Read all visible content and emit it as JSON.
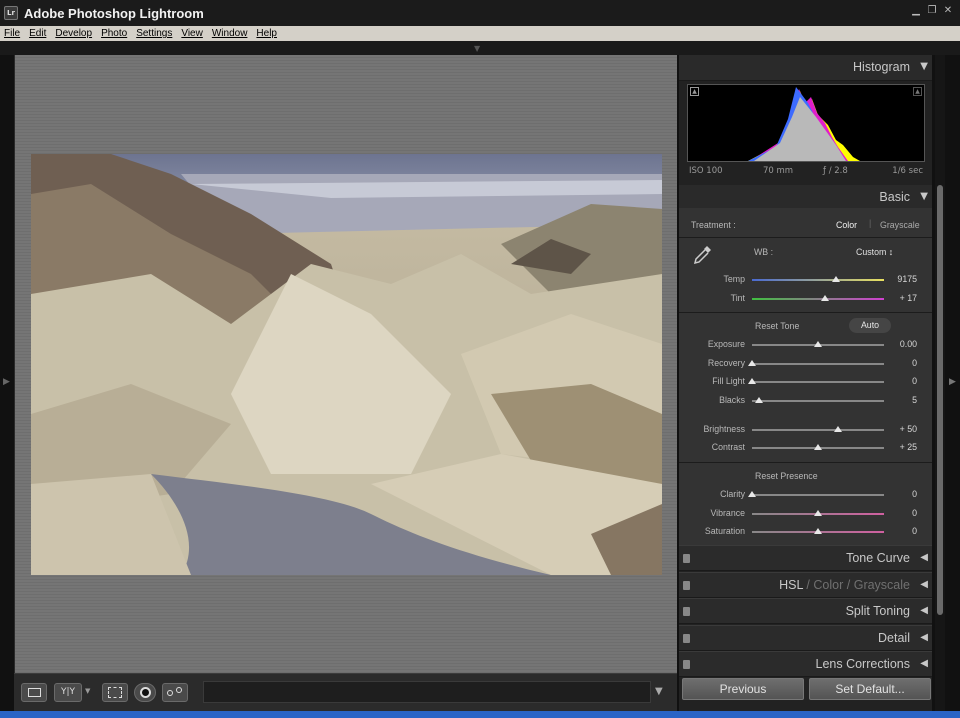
{
  "window": {
    "title": "Adobe Photoshop Lightroom",
    "icon_text": "Lr"
  },
  "menu": [
    "File",
    "Edit",
    "Develop",
    "Photo",
    "Settings",
    "View",
    "Window",
    "Help"
  ],
  "panels": {
    "histogram": {
      "title": "Histogram",
      "iso": "ISO 100",
      "focal": "70 mm",
      "aperture": "ƒ / 2.8",
      "shutter": "1/6 sec"
    },
    "basic": {
      "title": "Basic",
      "treatment_label": "Treatment :",
      "treatment_color": "Color",
      "treatment_grayscale": "Grayscale",
      "wb_label": "WB :",
      "wb_value": "Custom ↕",
      "temp": {
        "label": "Temp",
        "value": "9175",
        "level": 0.64
      },
      "tint": {
        "label": "Tint",
        "value": "+ 17",
        "level": 0.55
      },
      "reset_tone": "Reset Tone",
      "auto": "Auto",
      "exposure": {
        "label": "Exposure",
        "value": "0.00",
        "level": 0.5
      },
      "recovery": {
        "label": "Recovery",
        "value": "0",
        "level": 0.0
      },
      "fill_light": {
        "label": "Fill Light",
        "value": "0",
        "level": 0.0
      },
      "blacks": {
        "label": "Blacks",
        "value": "5",
        "level": 0.05
      },
      "brightness": {
        "label": "Brightness",
        "value": "+ 50",
        "level": 0.65
      },
      "contrast": {
        "label": "Contrast",
        "value": "+ 25",
        "level": 0.5
      },
      "reset_presence": "Reset Presence",
      "clarity": {
        "label": "Clarity",
        "value": "0",
        "level": 0.0
      },
      "vibrance": {
        "label": "Vibrance",
        "value": "0",
        "level": 0.5
      },
      "saturation": {
        "label": "Saturation",
        "value": "0",
        "level": 0.5
      }
    },
    "tone_curve": "Tone Curve",
    "hsl": {
      "hsl": "HSL",
      "color": "Color",
      "grayscale": "Grayscale",
      "slash": "/"
    },
    "split_toning": "Split Toning",
    "detail": "Detail",
    "lens_corrections": "Lens Corrections"
  },
  "buttons": {
    "previous": "Previous",
    "set_default": "Set Default..."
  },
  "toolbar": {
    "compare_label": "Y|Y"
  }
}
